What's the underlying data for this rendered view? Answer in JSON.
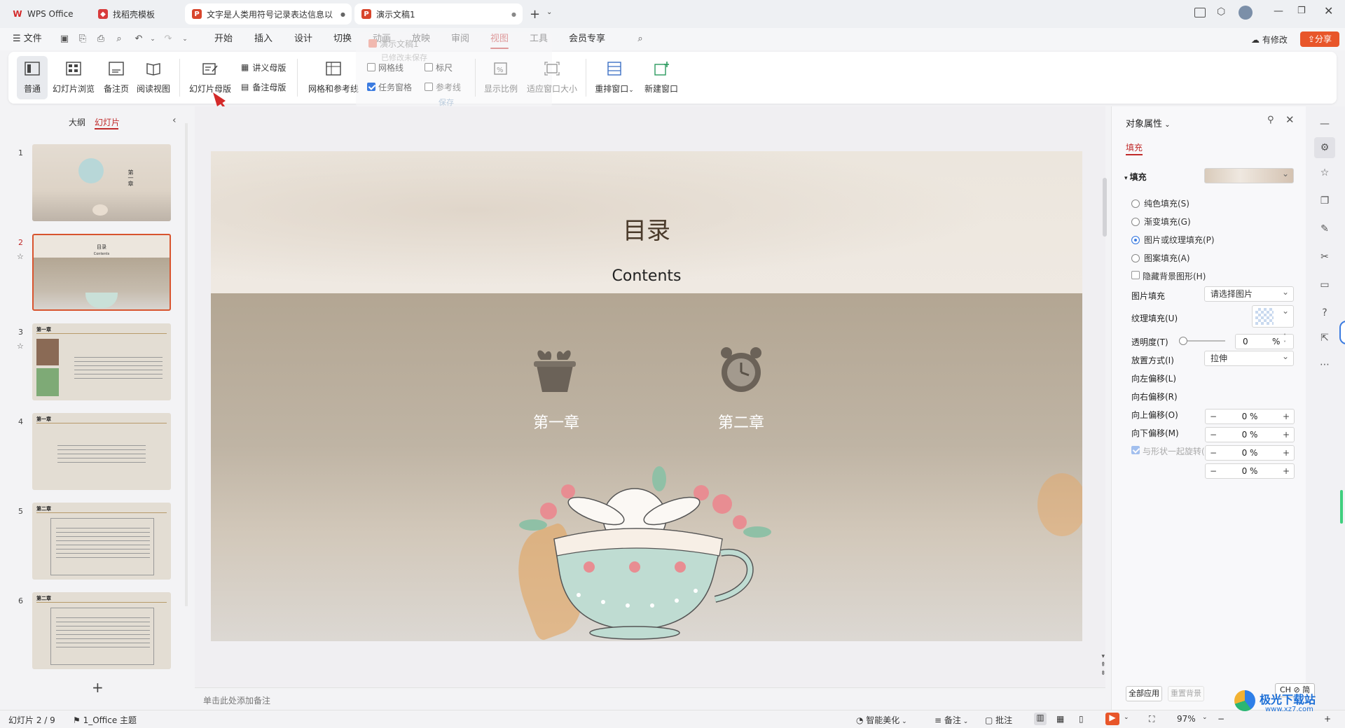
{
  "tabs": [
    {
      "label": "WPS Office",
      "icon": "wps-logo-icon"
    },
    {
      "label": "找稻壳模板",
      "icon": "docer-icon"
    },
    {
      "label": "文字是人类用符号记录表达信息以",
      "icon": "ppt-icon"
    },
    {
      "label": "演示文稿1",
      "icon": "ppt-icon"
    }
  ],
  "menu": {
    "file": "文件",
    "items": [
      "开始",
      "插入",
      "设计",
      "切换",
      "动画",
      "放映",
      "审阅",
      "视图",
      "工具",
      "会员专享"
    ],
    "active": "视图",
    "has_changes": "有修改",
    "share": "分享"
  },
  "ghost_popup": {
    "title": "演示文稿1",
    "subtitle": "已修改未保存",
    "save": "保存"
  },
  "ribbon": {
    "normal": "普通",
    "sorter": "幻灯片浏览",
    "notes_page": "备注页",
    "reading": "阅读视图",
    "slide_master": "幻灯片母版",
    "handout_master": "讲义母版",
    "notes_master": "备注母版",
    "grid_guides": "网格和参考线",
    "gridlines": "网格线",
    "ruler": "标尺",
    "task_pane": "任务窗格",
    "guides": "参考线",
    "zoom": "显示比例",
    "fit_window": "适应窗口大小",
    "arrange": "重排窗口",
    "new_window": "新建窗口"
  },
  "left_panel": {
    "outline_tab": "大纲",
    "slides_tab": "幻灯片",
    "slide_numbers": [
      "1",
      "2",
      "3",
      "4",
      "5",
      "6"
    ],
    "selected_slide": 2
  },
  "thumbs": {
    "s1_title": "第一章",
    "s2_title": "目录",
    "s2_sub": "Contents",
    "s3_title": "第一章",
    "s4_title": "第一章",
    "s5_title": "第二章",
    "s6_title": "第二章"
  },
  "slide": {
    "title": "目录",
    "subtitle": "Contents",
    "chapter1": "第一章",
    "chapter2": "第二章"
  },
  "notes_placeholder": "单击此处添加备注",
  "right_panel": {
    "title": "对象属性",
    "tab": "填充",
    "section": "填充",
    "options": [
      "纯色填充(S)",
      "渐变填充(G)",
      "图片或纹理填充(P)",
      "图案填充(A)"
    ],
    "selected_option": 2,
    "hide_bg": "隐藏背景图形(H)",
    "picture_fill_label": "图片填充",
    "picture_fill_value": "请选择图片",
    "texture_label": "纹理填充(U)",
    "transparency_label": "透明度(T)",
    "transparency_value": "0",
    "transparency_unit": "%",
    "placement_label": "放置方式(I)",
    "placement_value": "拉伸",
    "offsets": [
      {
        "label": "向左偏移(L)",
        "value": "0 %"
      },
      {
        "label": "向右偏移(R)",
        "value": "0 %"
      },
      {
        "label": "向上偏移(O)",
        "value": "0 %"
      },
      {
        "label": "向下偏移(M)",
        "value": "0 %"
      }
    ],
    "rotate_with_shape": "与形状一起旋转(W)",
    "apply_all": "全部应用",
    "reset_bg": "重置背景"
  },
  "status": {
    "slide_count": "幻灯片 2 / 9",
    "theme": "1_Office 主题",
    "beautify": "智能美化",
    "notes": "备注",
    "comments": "批注",
    "zoom": "97%",
    "ime": "CH ⊘ 简"
  },
  "watermark": {
    "site": "极光下载站",
    "url": "www.xz7.com"
  }
}
